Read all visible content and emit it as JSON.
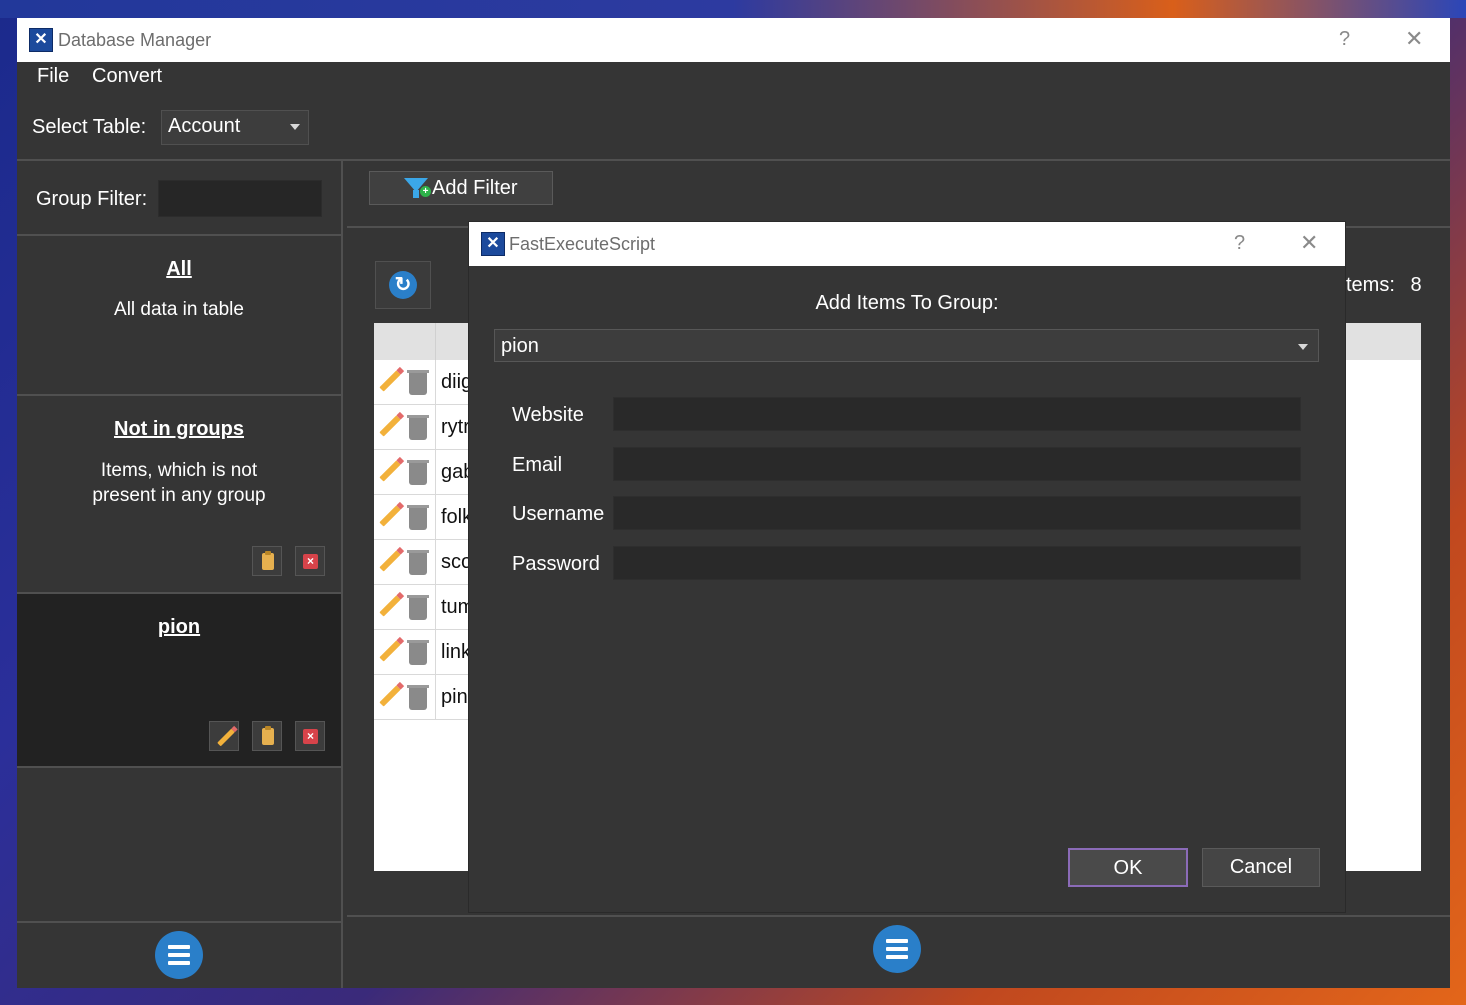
{
  "window": {
    "title": "Database Manager",
    "help": "?",
    "close": "✕"
  },
  "menu": {
    "items": [
      "File",
      "Convert"
    ]
  },
  "toolbar": {
    "select_table_label": "Select Table:",
    "table_value": "Account"
  },
  "sidebar": {
    "group_filter_label": "Group Filter:",
    "group_filter_value": "",
    "groups": [
      {
        "title": "All",
        "description": "All data in table"
      },
      {
        "title": "Not in groups",
        "description_line1": "Items, which is not",
        "description_line2": "present in any group"
      },
      {
        "title": "pion",
        "description": ""
      }
    ]
  },
  "main": {
    "add_filter_label": "Add Filter",
    "items_label": "tems:",
    "items_count": "8",
    "rows": [
      "diig",
      "rytr",
      "gab",
      "folk",
      "sco",
      "tum",
      "link",
      "pin"
    ]
  },
  "dialog": {
    "title": "FastExecuteScript",
    "help": "?",
    "close": "✕",
    "heading": "Add Items To Group:",
    "group_value": "pion",
    "fields": [
      {
        "label": "Website",
        "value": ""
      },
      {
        "label": "Email",
        "value": ""
      },
      {
        "label": "Username",
        "value": ""
      },
      {
        "label": "Password",
        "value": ""
      }
    ],
    "ok_label": "OK",
    "cancel_label": "Cancel"
  },
  "colors": {
    "accent": "#2a7fc9",
    "ok_border": "#8b6bb8",
    "window_bg": "#353535"
  }
}
